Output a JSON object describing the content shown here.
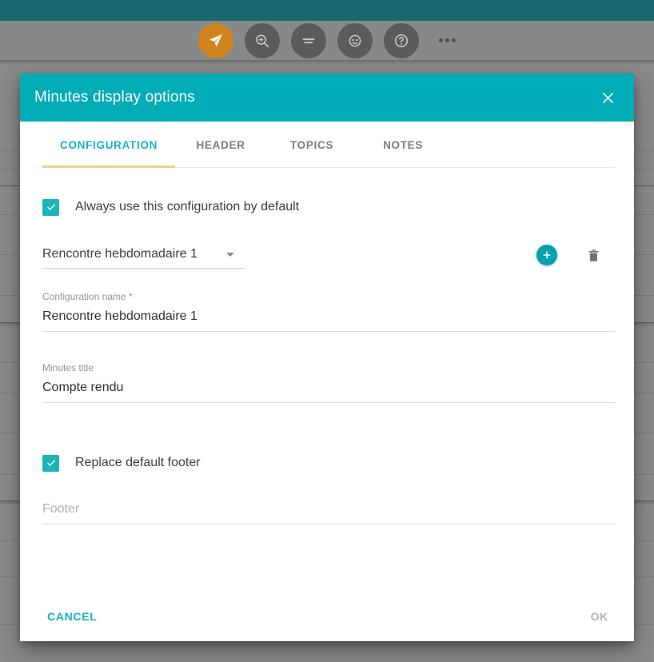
{
  "background": {
    "topbar_color": "#16686e",
    "toolbar_color": "#888888",
    "toolbar_icons": [
      {
        "name": "send-icon",
        "accent": true
      },
      {
        "name": "zoom-in-icon",
        "accent": false
      },
      {
        "name": "equals-icon",
        "accent": false
      },
      {
        "name": "face-icon",
        "accent": false
      },
      {
        "name": "help-icon",
        "accent": false
      }
    ],
    "overflow_menu": "more-options-icon"
  },
  "dialog": {
    "title": "Minutes display options",
    "header_color": "#00acb5",
    "close_label": "×",
    "tabs": [
      {
        "label": "CONFIGURATION",
        "active": true
      },
      {
        "label": "HEADER",
        "active": false
      },
      {
        "label": "TOPICS",
        "active": false
      },
      {
        "label": "NOTES",
        "active": false
      }
    ],
    "active_tab_indicator_color": "#f0d27a",
    "checkbox_default": {
      "label": "Always use this configuration by default",
      "checked": true
    },
    "config_select": {
      "value": "Rencontre hebdomadaire 1",
      "add_button": "add-configuration-button",
      "delete_button": "delete-configuration-button"
    },
    "fields": [
      {
        "label": "Configuration name *",
        "value": "Rencontre hebdomadaire 1",
        "placeholder": ""
      },
      {
        "label": "Minutes title",
        "value": "Compte rendu",
        "placeholder": ""
      }
    ],
    "checkbox_footer": {
      "label": "Replace default footer",
      "checked": true
    },
    "footer_field": {
      "label": "",
      "value": "",
      "placeholder": "Footer"
    },
    "actions": {
      "cancel_label": "CANCEL",
      "ok_label": "OK",
      "cancel_color": "#14b5bd",
      "ok_color": "#b4b4b4"
    }
  }
}
